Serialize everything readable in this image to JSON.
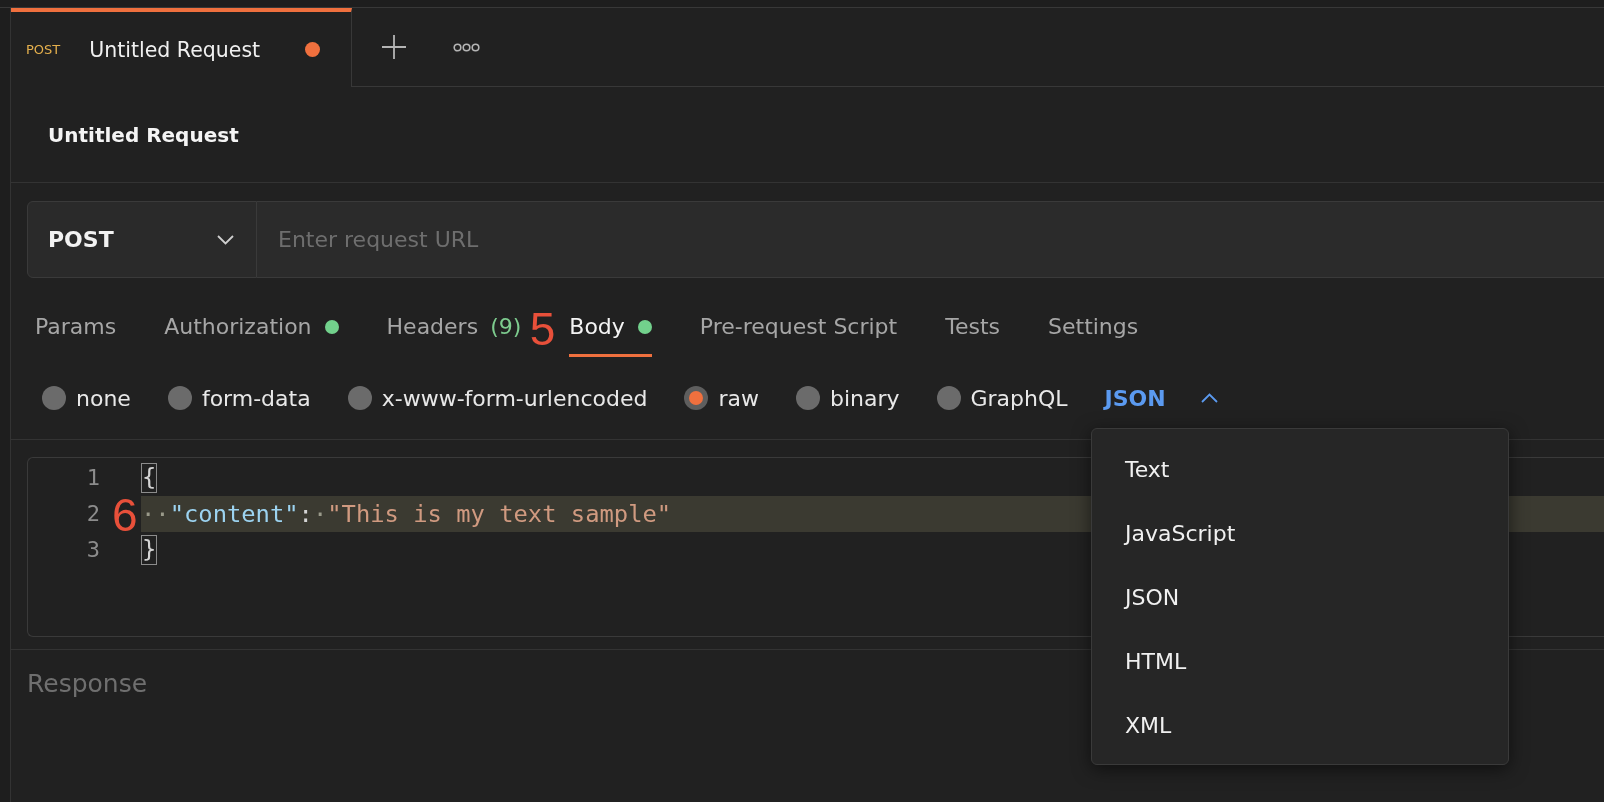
{
  "open_tabs": [
    {
      "method": "POST",
      "title": "Untitled Request",
      "selected": true,
      "unsaved": true
    }
  ],
  "request": {
    "name": "Untitled Request",
    "method": "POST",
    "url": {
      "placeholder": "Enter request URL"
    }
  },
  "request_tabs": [
    {
      "label": "Params",
      "selected": false,
      "indicator": false
    },
    {
      "label": "Authorization",
      "selected": false,
      "indicator": true
    },
    {
      "label": "Headers",
      "count": "(9)",
      "selected": false,
      "indicator": false
    },
    {
      "label": "Body",
      "selected": true,
      "indicator": true,
      "step_marker": "5"
    },
    {
      "label": "Pre-request Script",
      "selected": false,
      "indicator": false
    },
    {
      "label": "Tests",
      "selected": false,
      "indicator": false
    },
    {
      "label": "Settings",
      "selected": false,
      "indicator": false
    }
  ],
  "body_types": [
    {
      "label": "none",
      "selected": false
    },
    {
      "label": "form-data",
      "selected": false
    },
    {
      "label": "x-www-form-urlencoded",
      "selected": false
    },
    {
      "label": "raw",
      "selected": true
    },
    {
      "label": "binary",
      "selected": false
    },
    {
      "label": "GraphQL",
      "selected": false
    }
  ],
  "language_select": {
    "label": "JSON",
    "expanded": true
  },
  "editor": {
    "lines": [
      {
        "number": "1",
        "highlighted": false,
        "tokens": [
          {
            "kind": "brace",
            "text": "{"
          }
        ]
      },
      {
        "number": "2",
        "highlighted": true,
        "step_marker": "6",
        "tokens": [
          {
            "kind": "whitespace",
            "text": "··"
          },
          {
            "kind": "key",
            "text": "\"content\""
          },
          {
            "kind": "punct",
            "text": ":"
          },
          {
            "kind": "whitespace",
            "text": "·"
          },
          {
            "kind": "string",
            "text": "\"This is my text sample\""
          }
        ]
      },
      {
        "number": "3",
        "highlighted": false,
        "tokens": [
          {
            "kind": "brace",
            "text": "}"
          }
        ]
      }
    ]
  },
  "response": {
    "title": "Response"
  },
  "language_menu": {
    "items": [
      {
        "label": "Text"
      },
      {
        "label": "JavaScript"
      },
      {
        "label": "JSON"
      },
      {
        "label": "HTML"
      },
      {
        "label": "XML"
      }
    ]
  }
}
